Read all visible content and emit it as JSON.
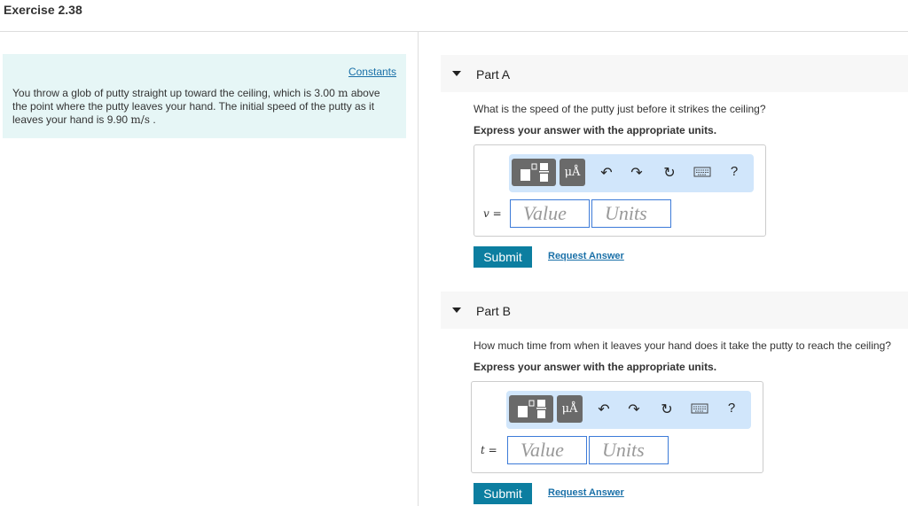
{
  "title": "Exercise 2.38",
  "intro": {
    "constants_link": "Constants",
    "text_1": "You throw a glob of putty straight up toward the ceiling, which is 3.00 ",
    "unit_m": "m",
    "text_2": " above the point where the putty leaves your hand. The initial speed of the putty as it leaves your hand is 9.90 ",
    "unit_ms": "m/s",
    "text_3": " ."
  },
  "parts": [
    {
      "label": "Part A",
      "question": "What is the speed of the putty just before it strikes the ceiling?",
      "instruction": "Express your answer with the appropriate units.",
      "variable": "v =",
      "value_placeholder": "Value",
      "units_placeholder": "Units",
      "units_button": "μÅ",
      "help": "?",
      "submit": "Submit",
      "request": "Request Answer"
    },
    {
      "label": "Part B",
      "question": "How much time from when it leaves your hand does it take the putty to reach the ceiling?",
      "instruction": "Express your answer with the appropriate units.",
      "variable": "t =",
      "value_placeholder": "Value",
      "units_placeholder": "Units",
      "units_button": "μÅ",
      "help": "?",
      "submit": "Submit",
      "request": "Request Answer"
    }
  ]
}
